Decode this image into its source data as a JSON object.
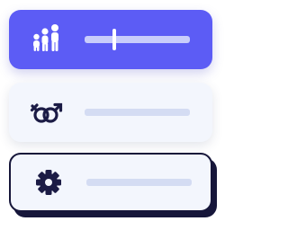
{
  "menu": {
    "items": [
      {
        "icon": "family-icon",
        "active": true,
        "slider_value": 0.28
      },
      {
        "icon": "gender-symbols-icon",
        "active": false
      },
      {
        "icon": "gear-icon",
        "active": false
      }
    ]
  },
  "colors": {
    "accent": "#5c5cf5",
    "card_background": "#f3f6fd",
    "icon_dark": "#1b1b45",
    "bar_on_accent": "#c9cdfb",
    "bar_light": "#d4dcf3",
    "outline": "#16163a"
  }
}
